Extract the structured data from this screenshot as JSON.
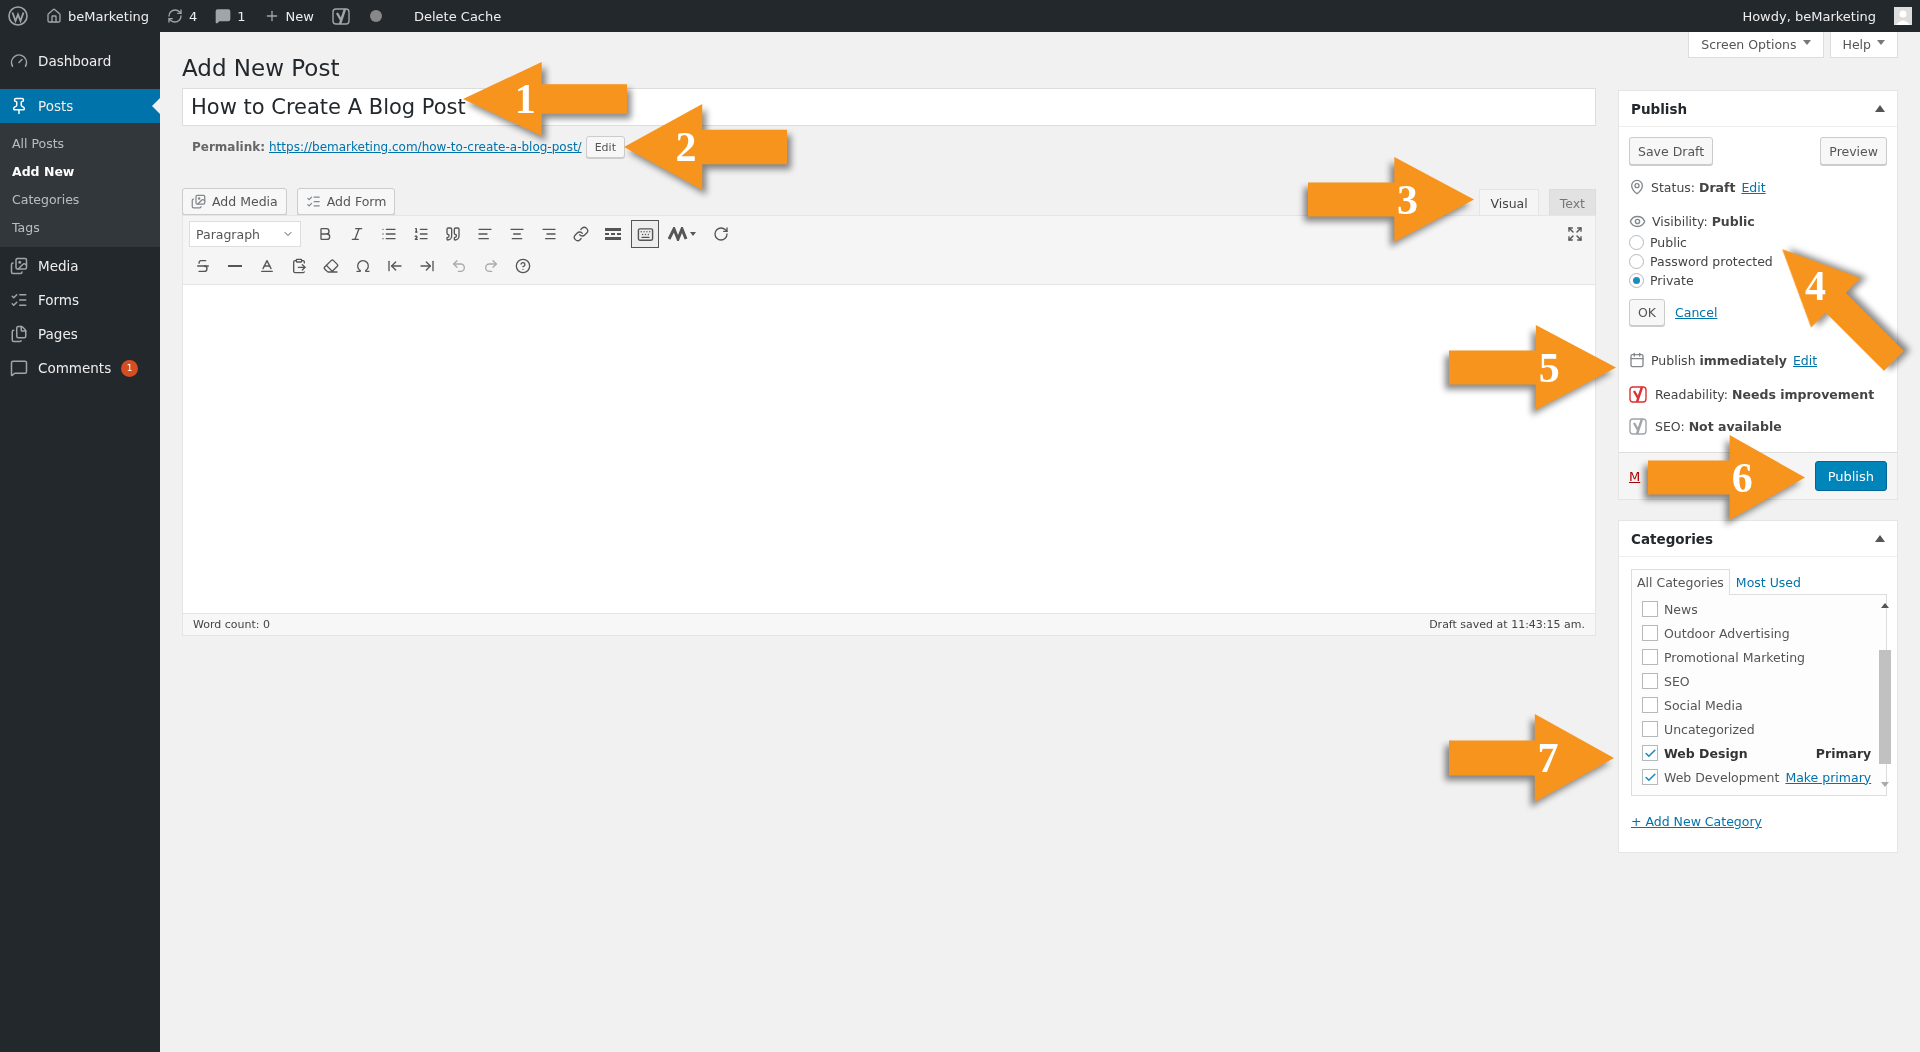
{
  "admin_bar": {
    "site": "beMarketing",
    "updates": "4",
    "comments": "1",
    "new": "New",
    "cache": "Delete Cache",
    "greeting": "Howdy, beMarketing"
  },
  "sidebar": {
    "items": [
      {
        "label": "Dashboard",
        "selected": false
      },
      {
        "label": "Posts",
        "selected": true,
        "children": [
          {
            "label": "All Posts",
            "selected": false
          },
          {
            "label": "Add New",
            "selected": true
          },
          {
            "label": "Categories",
            "selected": false
          },
          {
            "label": "Tags",
            "selected": false
          }
        ]
      },
      {
        "label": "Media",
        "selected": false
      },
      {
        "label": "Forms",
        "selected": false
      },
      {
        "label": "Pages",
        "selected": false
      },
      {
        "label": "Comments",
        "selected": false,
        "badge": "1"
      }
    ]
  },
  "screen_meta": [
    "Screen Options",
    "Help"
  ],
  "page_title": "Add New Post",
  "post_title": "How to Create A Blog Post",
  "permalink": {
    "label": "Permalink:",
    "url": "https://bemarketing.com/how-to-create-a-blog-post/",
    "button": "Edit"
  },
  "media_buttons": [
    "Add Media",
    "Add Form"
  ],
  "editor_tabs": [
    {
      "label": "Visual",
      "selected": true
    },
    {
      "label": "Text",
      "selected": false
    }
  ],
  "toolbar": {
    "format": "Paragraph",
    "toggle_pressed": true
  },
  "status_bar": {
    "word_count": "Word count: 0",
    "saved": "Draft saved at 11:43:15 am."
  },
  "publish": {
    "title": "Publish",
    "save": "Save Draft",
    "preview": "Preview",
    "status": {
      "label": "Status:",
      "value": "Draft",
      "link": "Edit"
    },
    "visibility": {
      "label": "Visibility:",
      "value": "Public"
    },
    "options": [
      {
        "label": "Public",
        "selected": false
      },
      {
        "label": "Password protected",
        "selected": false
      },
      {
        "label": "Private",
        "selected": true
      }
    ],
    "ok": "OK",
    "cancel": "Cancel",
    "schedule": {
      "label": "Publish",
      "value": "immediately",
      "link": "Edit"
    },
    "scores": [
      {
        "label": "Readability:",
        "value": "Needs improvement"
      },
      {
        "label": "SEO:",
        "value": "Not available"
      }
    ],
    "trash": "M",
    "button": "Publish"
  },
  "categories": {
    "title": "Categories",
    "tabs": [
      {
        "label": "All Categories",
        "selected": true
      },
      {
        "label": "Most Used",
        "selected": false
      }
    ],
    "items": [
      {
        "label": "News",
        "checked": false
      },
      {
        "label": "Outdoor Advertising",
        "checked": false
      },
      {
        "label": "Promotional Marketing",
        "checked": false
      },
      {
        "label": "SEO",
        "checked": false
      },
      {
        "label": "Social Media",
        "checked": false
      },
      {
        "label": "Uncategorized",
        "checked": false
      },
      {
        "label": "Web Design",
        "checked": true,
        "primary": true,
        "note": "Primary"
      },
      {
        "label": "Web Development",
        "checked": true,
        "primary": false,
        "note": "Make primary"
      }
    ],
    "add": "+ Add New Category"
  },
  "annotations": [
    "1",
    "2",
    "3",
    "4",
    "5",
    "6",
    "7"
  ]
}
